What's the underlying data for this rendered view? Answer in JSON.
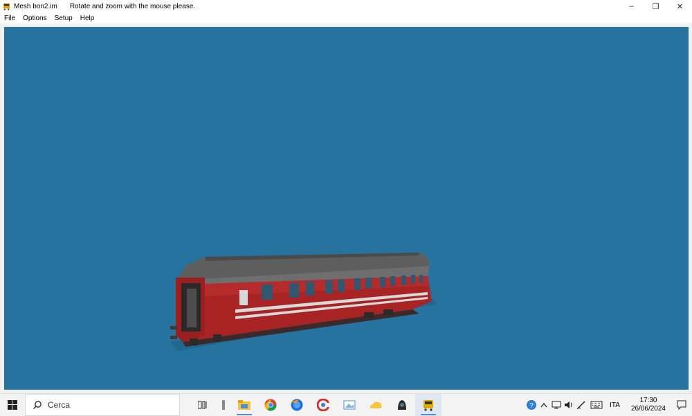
{
  "window": {
    "title": "Mesh bon2.im",
    "hint": "Rotate and zoom with the mouse please.",
    "minimize_label": "–",
    "restore_label": "❐",
    "close_label": "✕"
  },
  "menu": {
    "items": [
      {
        "label": "File"
      },
      {
        "label": "Options"
      },
      {
        "label": "Setup"
      },
      {
        "label": "Help"
      }
    ]
  },
  "viewport": {
    "background": "#2673a0",
    "model": "railway-passenger-coach",
    "coach_color": "#a32020",
    "roof_color": "#5a5a5a"
  },
  "taskbar": {
    "search_placeholder": "Cerca",
    "apps": [
      {
        "icon": "task-view-icon"
      },
      {
        "icon": "divider-icon"
      },
      {
        "icon": "file-explorer-icon"
      },
      {
        "icon": "chrome-icon"
      },
      {
        "icon": "firefox-icon"
      },
      {
        "icon": "ccleaner-icon"
      },
      {
        "icon": "image-viewer-icon"
      },
      {
        "icon": "folder-cloud-icon"
      },
      {
        "icon": "train-app-icon"
      },
      {
        "icon": "mesh-viewer-icon"
      }
    ],
    "tray": {
      "language": "ITA",
      "time": "17:30",
      "date": "26/06/2024"
    }
  }
}
